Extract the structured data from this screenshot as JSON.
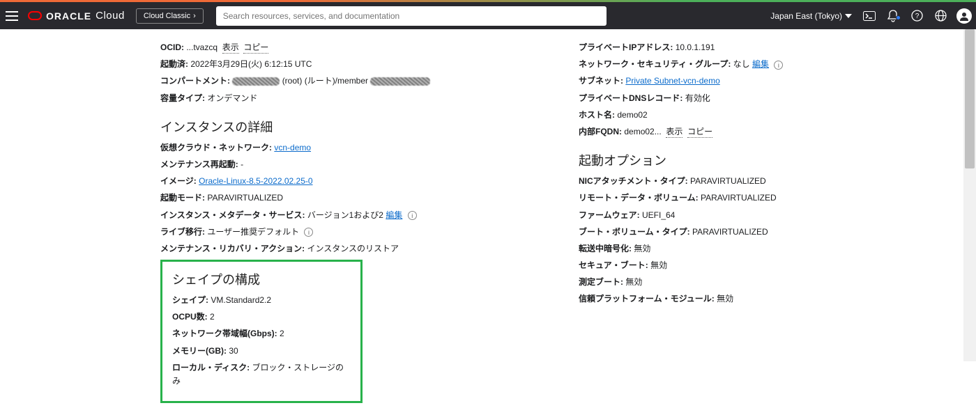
{
  "header": {
    "brand_word": "ORACLE",
    "brand_sub": "Cloud",
    "classic_label": "Cloud Classic",
    "search_placeholder": "Search resources, services, and documentation",
    "region": "Japan East (Tokyo)"
  },
  "left": {
    "ocid_label": "OCID:",
    "ocid_value": "...tvazcq",
    "show": "表示",
    "copy": "コピー",
    "started_label": "起動済:",
    "started_value": "2022年3月29日(火) 6:12:15 UTC",
    "compartment_label": "コンパートメント:",
    "compartment_root": "(root) (ルート)/member",
    "capacity_label": "容量タイプ:",
    "capacity_value": "オンデマンド",
    "details_heading": "インスタンスの詳細",
    "vcn_label": "仮想クラウド・ネットワーク:",
    "vcn_link": "vcn-demo",
    "maint_reboot_label": "メンテナンス再起動:",
    "maint_reboot_value": "-",
    "image_label": "イメージ:",
    "image_link": "Oracle-Linux-8.5-2022.02.25-0",
    "launch_mode_label": "起動モード:",
    "launch_mode_value": "PARAVIRTUALIZED",
    "imds_label": "インスタンス・メタデータ・サービス:",
    "imds_value": "バージョン1および2",
    "edit": "編集",
    "live_mig_label": "ライブ移行:",
    "live_mig_value": "ユーザー推奨デフォルト",
    "recov_label": "メンテナンス・リカバリ・アクション:",
    "recov_value": "インスタンスのリストア",
    "shape_heading": "シェイプの構成",
    "shape_label": "シェイプ:",
    "shape_value": "VM.Standard2.2",
    "ocpu_label": "OCPU数:",
    "ocpu_value": "2",
    "bw_label": "ネットワーク帯域幅(Gbps):",
    "bw_value": "2",
    "mem_label": "メモリー(GB):",
    "mem_value": "30",
    "disk_label": "ローカル・ディスク:",
    "disk_value": "ブロック・ストレージのみ"
  },
  "right": {
    "pip_label": "プライベートIPアドレス:",
    "pip_value": "10.0.1.191",
    "nsg_label": "ネットワーク・セキュリティ・グループ:",
    "nsg_value": "なし",
    "edit": "編集",
    "subnet_label": "サブネット:",
    "subnet_link": "Private Subnet-vcn-demo",
    "dns_label": "プライベートDNSレコード:",
    "dns_value": "有効化",
    "host_label": "ホスト名:",
    "host_value": "demo02",
    "fqdn_label": "内部FQDN:",
    "fqdn_value": "demo02...",
    "show": "表示",
    "copy": "コピー",
    "launch_opts_heading": "起動オプション",
    "nic_label": "NICアタッチメント・タイプ:",
    "nic_value": "PARAVIRTUALIZED",
    "rdv_label": "リモート・データ・ボリューム:",
    "rdv_value": "PARAVIRTUALIZED",
    "fw_label": "ファームウェア:",
    "fw_value": "UEFI_64",
    "bvt_label": "ブート・ボリューム・タイプ:",
    "bvt_value": "PARAVIRTUALIZED",
    "ite_label": "転送中暗号化:",
    "ite_value": "無効",
    "sb_label": "セキュア・ブート:",
    "sb_value": "無効",
    "mb_label": "測定ブート:",
    "mb_value": "無効",
    "tpm_label": "信頼プラットフォーム・モジュール:",
    "tpm_value": "無効"
  }
}
